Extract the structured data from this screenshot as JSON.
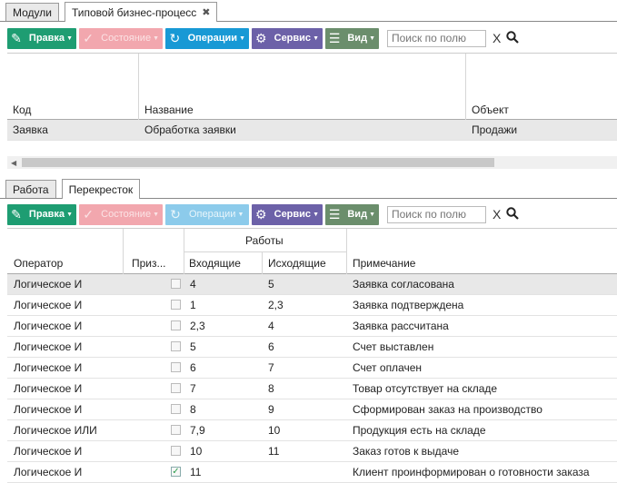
{
  "top_tabs": [
    {
      "label": "Модули"
    },
    {
      "label": "Типовой бизнес-процесс",
      "close": "✖"
    }
  ],
  "toolbar1": {
    "edit": "Правка",
    "state": "Состояние",
    "ops": "Операции",
    "service": "Сервис",
    "view": "Вид",
    "search_placeholder": "Поиск по полю",
    "clear": "X"
  },
  "grid1": {
    "columns": {
      "code": "Код",
      "name": "Название",
      "object": "Объект"
    },
    "row": {
      "code": "Заявка",
      "name": "Обработка заявки",
      "object": "Продажи"
    }
  },
  "bottom_tabs": [
    {
      "label": "Работа"
    },
    {
      "label": "Перекресток"
    }
  ],
  "toolbar2": {
    "edit": "Правка",
    "state": "Состояние",
    "ops": "Операции",
    "service": "Сервис",
    "view": "Вид",
    "search_placeholder": "Поиск по полю",
    "clear": "X"
  },
  "grid2": {
    "columns": {
      "operator": "Оператор",
      "flag": "Приз...",
      "group": "Работы",
      "incoming": "Входящие",
      "outgoing": "Исходящие",
      "note": "Примечание"
    },
    "rows": [
      {
        "operator": "Логическое И",
        "checked": false,
        "in": "4",
        "out": "5",
        "note": "Заявка согласована"
      },
      {
        "operator": "Логическое И",
        "checked": false,
        "in": "1",
        "out": "2,3",
        "note": "Заявка подтверждена"
      },
      {
        "operator": "Логическое И",
        "checked": false,
        "in": "2,3",
        "out": "4",
        "note": "Заявка рассчитана"
      },
      {
        "operator": "Логическое И",
        "checked": false,
        "in": "5",
        "out": "6",
        "note": "Счет выставлен"
      },
      {
        "operator": "Логическое И",
        "checked": false,
        "in": "6",
        "out": "7",
        "note": "Счет оплачен"
      },
      {
        "operator": "Логическое И",
        "checked": false,
        "in": "7",
        "out": "8",
        "note": "Товар отсутствует на складе"
      },
      {
        "operator": "Логическое И",
        "checked": false,
        "in": "8",
        "out": "9",
        "note": "Сформирован заказ на производство"
      },
      {
        "operator": "Логическое ИЛИ",
        "checked": false,
        "in": "7,9",
        "out": "10",
        "note": "Продукция есть на складе"
      },
      {
        "operator": "Логическое И",
        "checked": false,
        "in": "10",
        "out": "11",
        "note": "Заказ готов к выдаче"
      },
      {
        "operator": "Логическое И",
        "checked": true,
        "in": "11",
        "out": "",
        "note": "Клиент проинформирован о готовности заказа"
      }
    ]
  },
  "colors": {
    "edit": "#1e9d72",
    "state": "#f2a7ae",
    "ops": "#1899d5",
    "service": "#6c61a8",
    "view": "#6b8e6c"
  }
}
